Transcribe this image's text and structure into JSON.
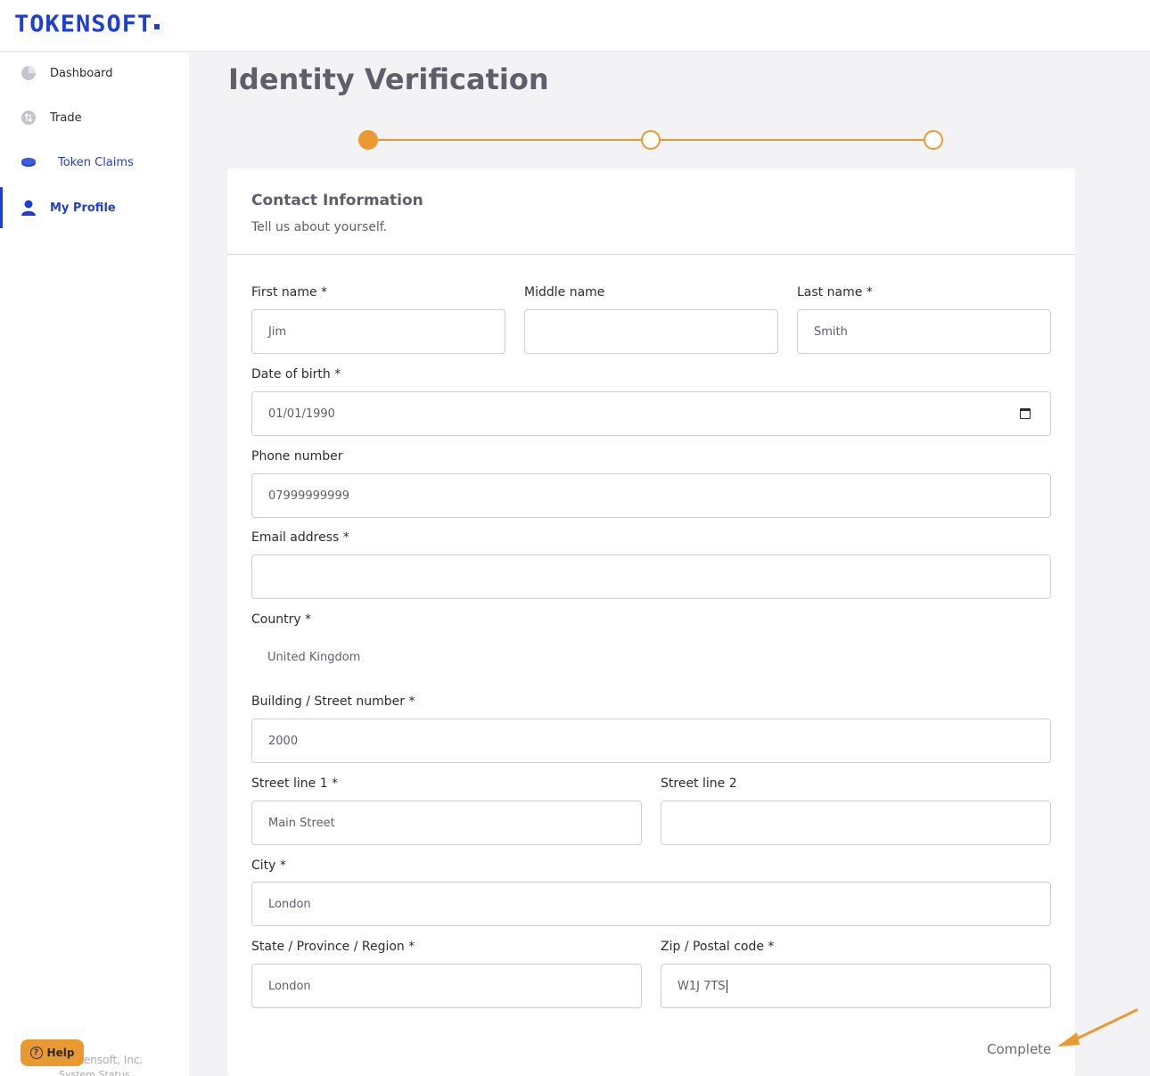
{
  "header": {
    "logo": "TOKENSOFT"
  },
  "sidebar": {
    "items": [
      {
        "label": "Dashboard",
        "icon": "pie-chart-icon"
      },
      {
        "label": "Trade",
        "icon": "trade-icon"
      },
      {
        "label": "Token Claims",
        "icon": "token-coin-icon"
      },
      {
        "label": "My Profile",
        "icon": "user-icon",
        "active": true
      }
    ],
    "help_label": "Help",
    "footer_company": "okensoft, Inc.",
    "footer_status": "System Status"
  },
  "page": {
    "title": "Identity Verification"
  },
  "stepper": {
    "steps": 3,
    "current": 1
  },
  "form": {
    "title": "Contact Information",
    "subtitle": "Tell us about yourself.",
    "first_name": {
      "label": "First name *",
      "value": "Jim"
    },
    "middle_name": {
      "label": "Middle name",
      "value": ""
    },
    "last_name": {
      "label": "Last name *",
      "value": "Smith"
    },
    "dob": {
      "label": "Date of birth *",
      "value": "01/01/1990"
    },
    "phone": {
      "label": "Phone number",
      "value": "07999999999"
    },
    "email": {
      "label": "Email address *",
      "value": ""
    },
    "country": {
      "label": "Country *",
      "value": "United Kingdom"
    },
    "building": {
      "label": "Building / Street number *",
      "value": "2000"
    },
    "street1": {
      "label": "Street line 1 *",
      "value": "Main Street"
    },
    "street2": {
      "label": "Street line 2",
      "value": ""
    },
    "city": {
      "label": "City *",
      "value": "London"
    },
    "state": {
      "label": "State / Province / Region *",
      "value": "London"
    },
    "zip": {
      "label": "Zip / Postal code *",
      "value": "W1J 7TS"
    },
    "complete_label": "Complete"
  },
  "colors": {
    "brand": "#1f3fd0",
    "accent": "#e89a30"
  }
}
